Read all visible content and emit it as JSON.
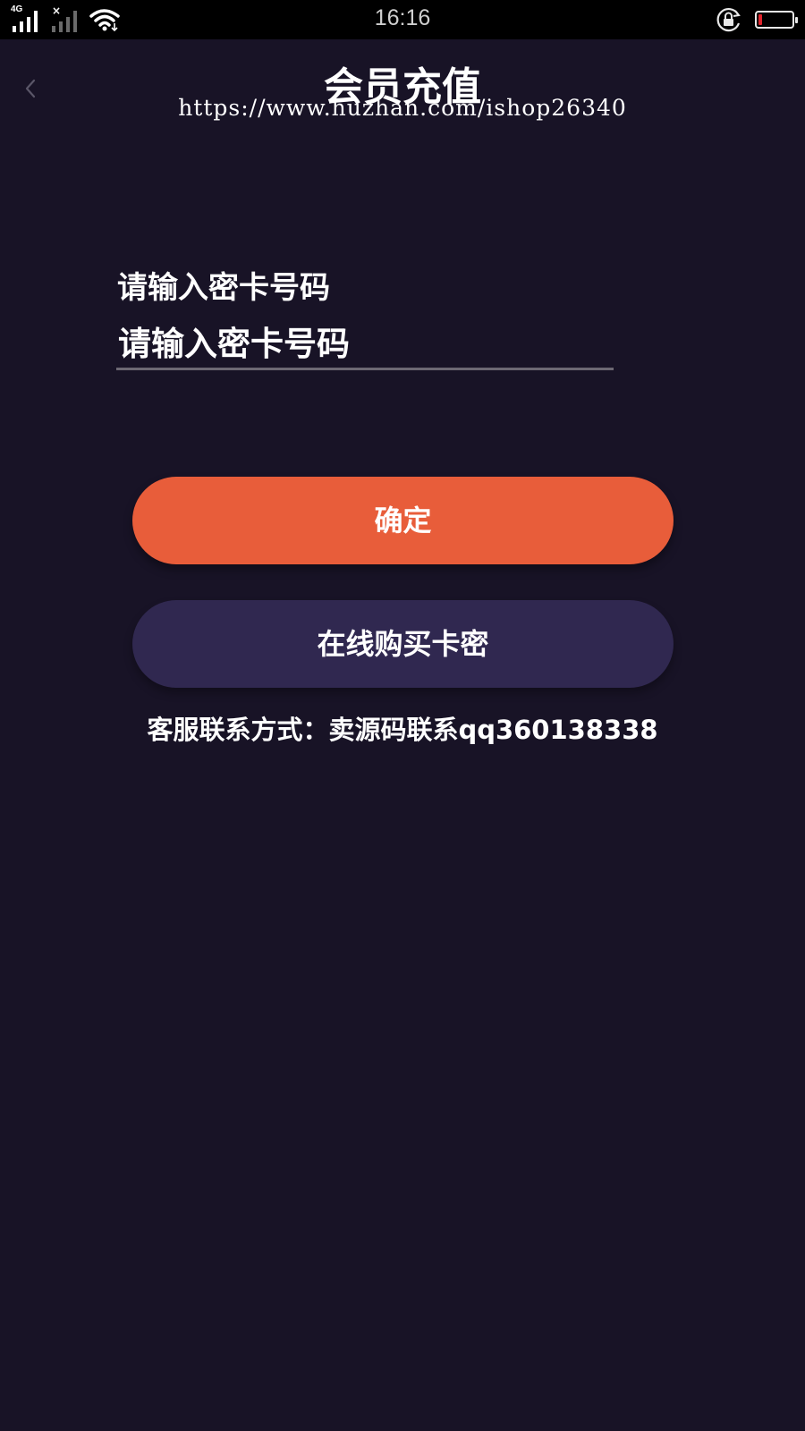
{
  "status_bar": {
    "time": "16:16",
    "network_type": "4G",
    "sim2_status": "×",
    "battery_level": 0.12,
    "battery_color": "#e0242c",
    "icons": [
      "signal-icon",
      "signal-dim-icon",
      "wifi-icon",
      "rotation-lock-icon",
      "battery-icon"
    ]
  },
  "header": {
    "title": "会员充值",
    "back_icon": "chevron-left-icon",
    "watermark": "https://www.huzhan.com/ishop26340"
  },
  "form": {
    "label": "请输入密卡号码",
    "input_placeholder": "请输入密卡号码",
    "input_value": ""
  },
  "buttons": {
    "confirm_label": "确定",
    "buy_label": "在线购买卡密"
  },
  "contact": {
    "text": "客服联系方式：卖源码联系qq360138338"
  },
  "colors": {
    "background": "#181326",
    "confirm_button": "#e85d3a",
    "buy_button": "#302850",
    "status_bar": "#000000"
  }
}
